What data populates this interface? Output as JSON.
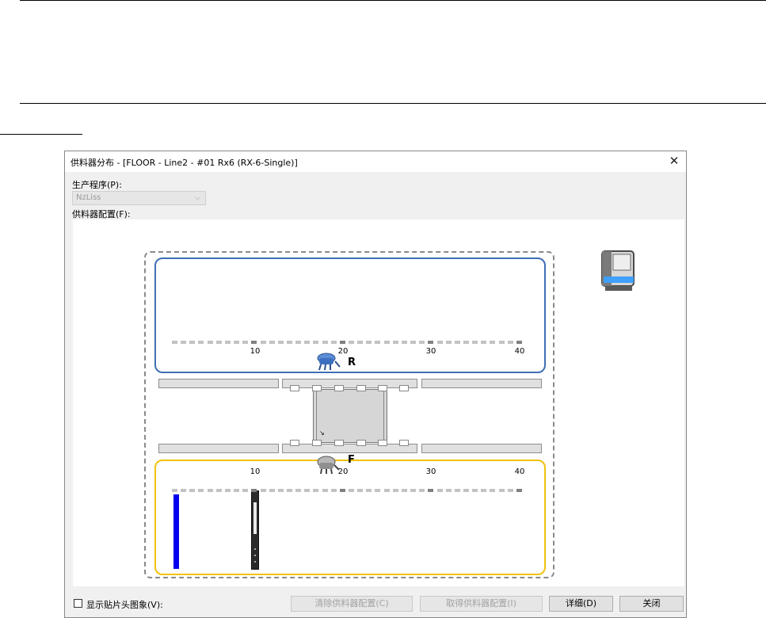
{
  "window": {
    "title": "供料器分布 - [FLOOR - Line2 - #01 Rx6 (RX-6-Single)]",
    "close_glyph": "✕"
  },
  "program": {
    "label": "生产程序(P):",
    "selected": "NzLiss"
  },
  "feeder_config": {
    "label": "供料器配置(F):"
  },
  "rear": {
    "label": "R",
    "ticks": [
      "10",
      "20",
      "30",
      "40"
    ]
  },
  "front": {
    "label": "F",
    "ticks": [
      "10",
      "20",
      "30",
      "40"
    ]
  },
  "colors": {
    "rear_border": "#3f6fb5",
    "front_border": "#f2c10d",
    "feeder_bar": "#0000ee"
  },
  "footer": {
    "show_image_label": "显示贴片头图象(V):",
    "clear_button": "清除供料器配置(C)",
    "get_button": "取得供料器配置(I)",
    "detail_button": "详细(D)",
    "close_button": "关闭"
  },
  "icons": {
    "machine": "machine-icon",
    "rear_head": "placement-head-icon",
    "front_head": "placement-head-icon",
    "close": "close-icon",
    "dropdown": "chevron-down-icon"
  }
}
